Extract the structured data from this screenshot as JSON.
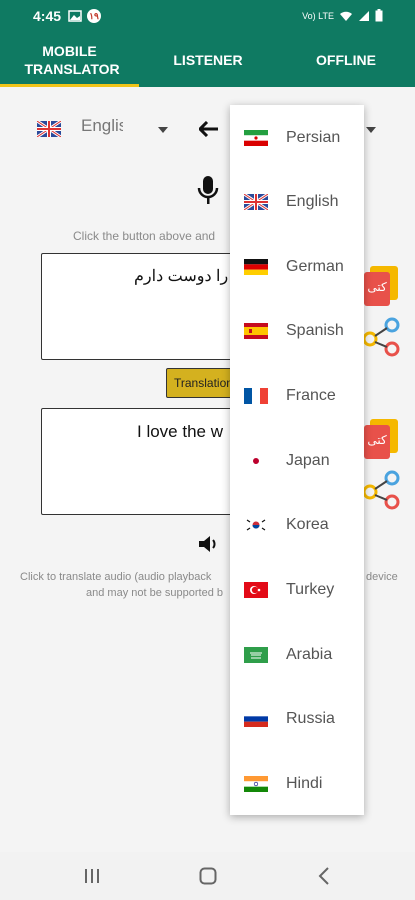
{
  "status": {
    "time": "4:45",
    "badge": "١٩",
    "signal_text": "Vo) LTE",
    "colors": {
      "bar": "#0f7a62"
    }
  },
  "tabs": [
    {
      "label": "MOBILE TRANSLATOR",
      "active": true
    },
    {
      "label": "LISTENER",
      "active": false
    },
    {
      "label": "OFFLINE",
      "active": false
    }
  ],
  "lang_row": {
    "source_lang": "English",
    "source_flag": "uk-flag-icon",
    "swap_icon": "arrow-left-icon"
  },
  "mic_hint": "Click the button above and",
  "input_text": "یا را دوست دارم",
  "translate_button": "Translation",
  "output_text": "I love the w",
  "audio_hint_line1": "Click to translate audio (audio playback",
  "audio_hint_line1_end": "device",
  "audio_hint_line2": "and may not be supported b",
  "dropdown": [
    {
      "label": "Persian",
      "flag": "iran-flag-icon"
    },
    {
      "label": "English",
      "flag": "uk-flag-icon"
    },
    {
      "label": "German",
      "flag": "germany-flag-icon"
    },
    {
      "label": "Spanish",
      "flag": "spain-flag-icon"
    },
    {
      "label": "France",
      "flag": "france-flag-icon"
    },
    {
      "label": "Japan",
      "flag": "japan-flag-icon"
    },
    {
      "label": "Korea",
      "flag": "korea-flag-icon"
    },
    {
      "label": "Turkey",
      "flag": "turkey-flag-icon"
    },
    {
      "label": "Arabia",
      "flag": "saudi-flag-icon"
    },
    {
      "label": "Russia",
      "flag": "russia-flag-icon"
    },
    {
      "label": "Hindi",
      "flag": "india-flag-icon"
    }
  ],
  "side_badge_text": "کتی",
  "colors": {
    "accent": "#f0c419",
    "translate_btn": "#d4b11f",
    "teal": "#0f7a62"
  }
}
